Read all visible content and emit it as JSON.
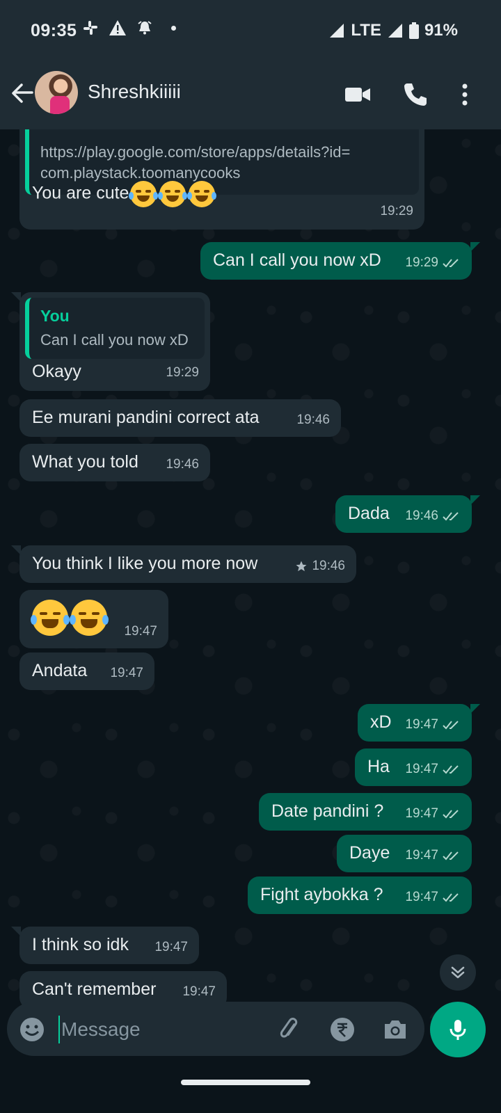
{
  "status_bar": {
    "time": "09:35",
    "network": "LTE",
    "battery": "91%"
  },
  "header": {
    "contact_name": "Shreshkiiiii"
  },
  "messages": [
    {
      "id": "m1",
      "dir": "in",
      "quote_link": "https://play.google.com/store/apps/details?id=",
      "quote_link2": "com.playstack.toomanycooks",
      "text": "You are cute",
      "time": "19:29"
    },
    {
      "id": "m2",
      "dir": "out",
      "text": "Can I call you now xD",
      "time": "19:29"
    },
    {
      "id": "m3",
      "dir": "in",
      "quote_author": "You",
      "quote_text": "Can I call you now xD",
      "text": "Okayy",
      "time": "19:29"
    },
    {
      "id": "m4",
      "dir": "in",
      "text": "Ee murani pandini correct ata",
      "time": "19:46"
    },
    {
      "id": "m5",
      "dir": "in",
      "text": "What you told",
      "time": "19:46"
    },
    {
      "id": "m6",
      "dir": "out",
      "text": "Dada",
      "time": "19:46"
    },
    {
      "id": "m7",
      "dir": "in",
      "text": "You think I like you more now",
      "time": "19:46",
      "starred": true
    },
    {
      "id": "m8",
      "dir": "in",
      "text": "",
      "time": "19:47"
    },
    {
      "id": "m9",
      "dir": "in",
      "text": "Andata",
      "time": "19:47"
    },
    {
      "id": "m10",
      "dir": "out",
      "text": "xD",
      "time": "19:47"
    },
    {
      "id": "m11",
      "dir": "out",
      "text": "Ha",
      "time": "19:47"
    },
    {
      "id": "m12",
      "dir": "out",
      "text": "Date pandini ?",
      "time": "19:47"
    },
    {
      "id": "m13",
      "dir": "out",
      "text": "Daye",
      "time": "19:47"
    },
    {
      "id": "m14",
      "dir": "out",
      "text": "Fight aybokka ?",
      "time": "19:47"
    },
    {
      "id": "m15",
      "dir": "in",
      "text": "I think so idk",
      "time": "19:47"
    },
    {
      "id": "m16",
      "dir": "in",
      "text": "Can't remember",
      "time": "19:47"
    }
  ],
  "composer": {
    "placeholder": "Message"
  },
  "colors": {
    "accent": "#00a884",
    "outgoing_bubble": "#005c4b",
    "incoming_bubble": "#1f2c34",
    "read_ticks": "#b5d8cf"
  },
  "icons": [
    "back-arrow-icon",
    "video-call-icon",
    "phone-icon",
    "more-vert-icon",
    "double-check-icon",
    "star-icon",
    "chevron-double-down-icon",
    "emoji-icon",
    "attach-icon",
    "rupee-payment-icon",
    "camera-icon",
    "mic-icon"
  ]
}
